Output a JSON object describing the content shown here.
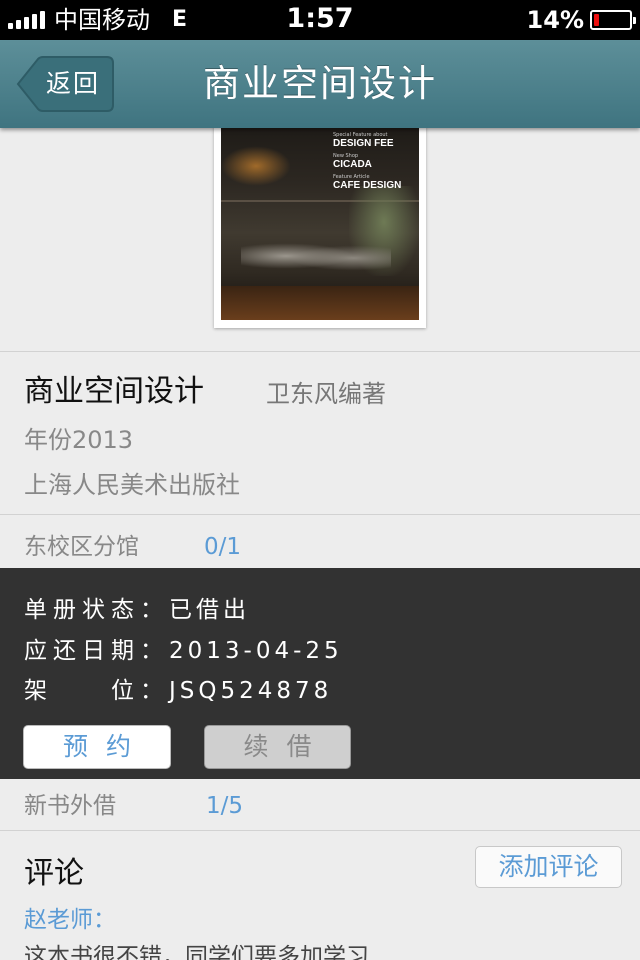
{
  "status_bar": {
    "carrier": "中国移动",
    "network": "E",
    "time": "1:57",
    "battery_percent": "14%",
    "battery_level": 0.14,
    "battery_color": "#ee1111"
  },
  "nav": {
    "back_label": "返回",
    "title": "商业空间设计"
  },
  "cover": {
    "lines": [
      {
        "small": "Special Feature about",
        "big": "DESIGN FEE"
      },
      {
        "small": "New Shop",
        "big": "CICADA"
      },
      {
        "small": "Feature Article",
        "big": "CAFE DESIGN"
      }
    ]
  },
  "book": {
    "title": "商业空间设计",
    "author": "卫东风编著",
    "year": "年份2013",
    "publisher": "上海人民美术出版社"
  },
  "holdings": {
    "branch": {
      "name": "东校区分馆",
      "count": "0/1"
    },
    "detail": {
      "status_key": "单册状态",
      "status_value": "已借出",
      "due_key": "应还日期",
      "due_value": "2013-04-25",
      "shelf_key": "架　　位",
      "shelf_value": "JSQ524878",
      "separator": "："
    },
    "reserve_label": "预约",
    "renew_label": "续借",
    "new_books": {
      "name": "新书外借",
      "count": "1/5"
    }
  },
  "comments": {
    "title": "评论",
    "add_label": "添加评论",
    "items": [
      {
        "author": "赵老师：",
        "text": "这本书很不错，同学们要多加学习"
      }
    ]
  },
  "colors": {
    "nav_bar": "#4a7f8a",
    "accent_blue": "#5b9bd5",
    "panel": "#323232"
  }
}
